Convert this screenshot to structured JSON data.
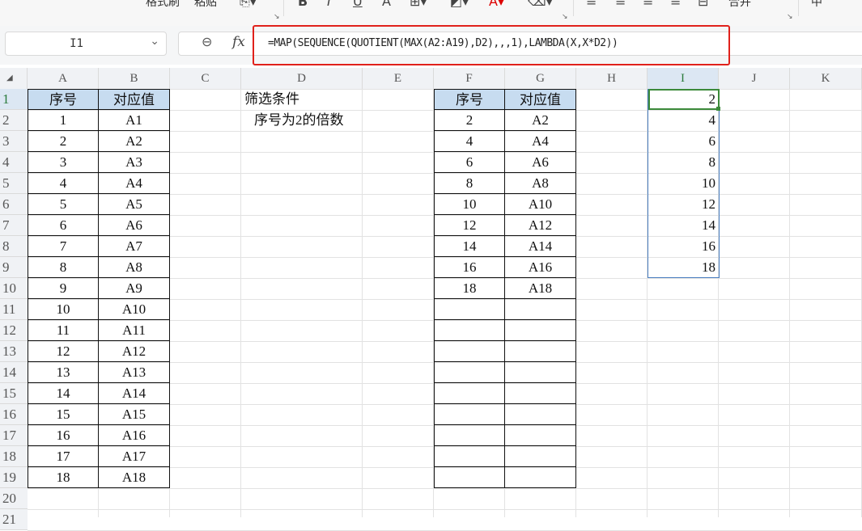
{
  "ribbon": {
    "format_painter": "格式刷",
    "paste": "粘贴",
    "merge": "合并",
    "center_align": "中"
  },
  "name_box": {
    "value": "I1"
  },
  "formula_bar": {
    "fx_label": "fx",
    "formula": "=MAP(SEQUENCE(QUOTIENT(MAX(A2:A19),D2),,,1),LAMBDA(X,X*D2))"
  },
  "columns": [
    "A",
    "B",
    "C",
    "D",
    "E",
    "F",
    "G",
    "H",
    "I",
    "J",
    "K"
  ],
  "rows": [
    "1",
    "2",
    "3",
    "4",
    "5",
    "6",
    "7",
    "8",
    "9",
    "10",
    "11",
    "12",
    "13",
    "14",
    "15",
    "16",
    "17",
    "18",
    "19",
    "20",
    "21"
  ],
  "table1": {
    "headers": [
      "序号",
      "对应值"
    ],
    "rows": [
      [
        "1",
        "A1"
      ],
      [
        "2",
        "A2"
      ],
      [
        "3",
        "A3"
      ],
      [
        "4",
        "A4"
      ],
      [
        "5",
        "A5"
      ],
      [
        "6",
        "A6"
      ],
      [
        "7",
        "A7"
      ],
      [
        "8",
        "A8"
      ],
      [
        "9",
        "A9"
      ],
      [
        "10",
        "A10"
      ],
      [
        "11",
        "A11"
      ],
      [
        "12",
        "A12"
      ],
      [
        "13",
        "A13"
      ],
      [
        "14",
        "A14"
      ],
      [
        "15",
        "A15"
      ],
      [
        "16",
        "A16"
      ],
      [
        "17",
        "A17"
      ],
      [
        "18",
        "A18"
      ]
    ]
  },
  "filter": {
    "label": "筛选条件",
    "value": "序号为2的倍数"
  },
  "table2": {
    "headers": [
      "序号",
      "对应值"
    ],
    "rows": [
      [
        "2",
        "A2"
      ],
      [
        "4",
        "A4"
      ],
      [
        "6",
        "A6"
      ],
      [
        "8",
        "A8"
      ],
      [
        "10",
        "A10"
      ],
      [
        "12",
        "A12"
      ],
      [
        "14",
        "A14"
      ],
      [
        "16",
        "A16"
      ],
      [
        "18",
        "A18"
      ],
      [
        "",
        ""
      ],
      [
        "",
        ""
      ],
      [
        "",
        ""
      ],
      [
        "",
        ""
      ],
      [
        "",
        ""
      ],
      [
        "",
        ""
      ],
      [
        "",
        ""
      ],
      [
        "",
        ""
      ],
      [
        "",
        ""
      ]
    ]
  },
  "result_column": [
    "2",
    "4",
    "6",
    "8",
    "10",
    "12",
    "14",
    "16",
    "18"
  ],
  "selected_column": "I",
  "selected_row": "1",
  "colors": {
    "header_fill": "#c7dcf0",
    "selection": "#3c8a3a",
    "highlight_box": "#e0211b"
  }
}
